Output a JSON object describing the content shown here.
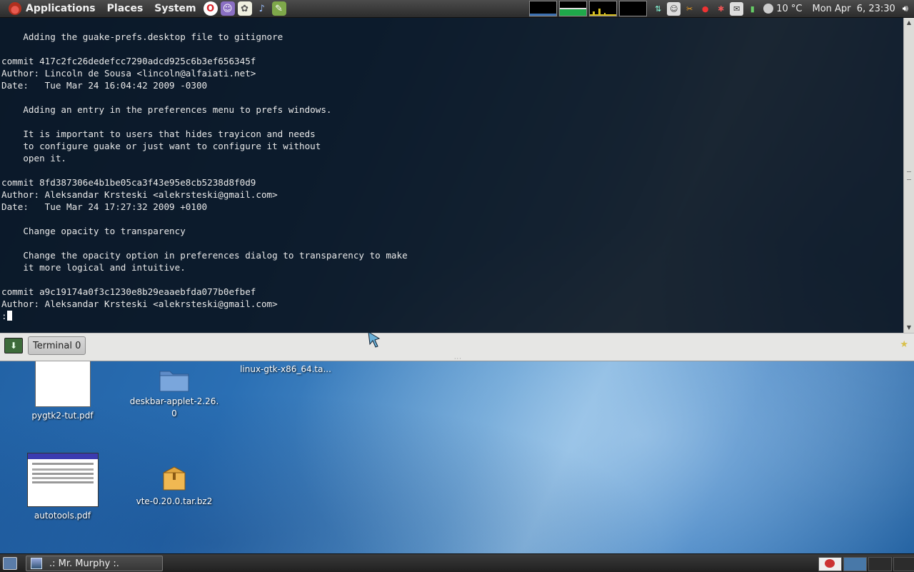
{
  "top_panel": {
    "menus": [
      "Applications",
      "Places",
      "System"
    ],
    "launchers": [
      {
        "icon": "opera-icon",
        "color": "#d8232a",
        "glyph": "O"
      },
      {
        "icon": "pidgin-icon",
        "color": "#8a6fc2",
        "glyph": "☺"
      },
      {
        "icon": "sheep-icon",
        "color": "#f0f0e0",
        "glyph": "✿"
      },
      {
        "icon": "music-note-icon",
        "color": "#5f8fd8",
        "glyph": "♪"
      },
      {
        "icon": "text-editor-icon",
        "color": "#9ac25a",
        "glyph": "✎"
      }
    ],
    "tray_icons": [
      "network-icon",
      "chat-icon",
      "scissors-icon",
      "record-icon",
      "bluetooth-icon",
      "mail-icon",
      "battery-icon"
    ],
    "weather": "10 °C",
    "clock": "Mon Apr  6, 23:30"
  },
  "desktop_icons": [
    {
      "label": "pygtk2-tut.pdf",
      "icon": "pdf-document-icon"
    },
    {
      "label": "deskbar-applet-2.26.\n0",
      "icon": "folder-icon"
    },
    {
      "label": "linux-gtk-x86_64.ta...",
      "icon": "archive-icon"
    },
    {
      "label": "autotools.pdf",
      "icon": "pdf-document-icon"
    },
    {
      "label": "vte-0.20.0.tar.bz2",
      "icon": "archive-icon"
    }
  ],
  "terminal": {
    "lines": [
      "    Adding the guake-prefs.desktop file to gitignore",
      "",
      "commit 417c2fc26dedefcc7290adcd925c6b3ef656345f",
      "Author: Lincoln de Sousa <lincoln@alfaiati.net>",
      "Date:   Tue Mar 24 16:04:42 2009 -0300",
      "",
      "    Adding an entry in the preferences menu to prefs windows.",
      "",
      "    It is important to users that hides trayicon and needs",
      "    to configure guake or just want to configure it without",
      "    open it.",
      "",
      "commit 8fd387306e4b1be05ca3f43e95e8cb5238d8f0d9",
      "Author: Aleksandar Krsteski <alekrsteski@gmail.com>",
      "Date:   Tue Mar 24 17:27:32 2009 +0100",
      "",
      "    Change opacity to transparency",
      "",
      "    Change the opacity option in preferences dialog to transparency to make",
      "    it more logical and intuitive.",
      "",
      "commit a9c19174a0f3c1230e8b29eaaebfda077b0efbef",
      "Author: Aleksandar Krsteski <alekrsteski@gmail.com>"
    ],
    "prompt": ":",
    "tab_label": "Terminal 0"
  },
  "taskbar": {
    "window_title": ".: Mr. Murphy :."
  }
}
